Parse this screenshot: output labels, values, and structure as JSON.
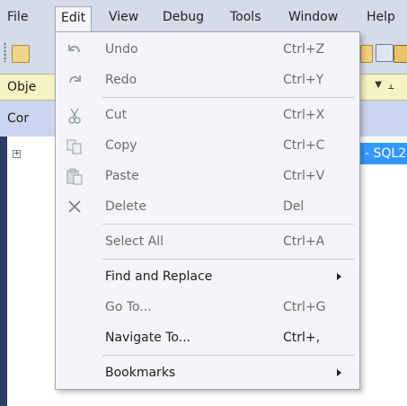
{
  "menubar": {
    "items": [
      "File",
      "Edit",
      "View",
      "Debug",
      "Tools",
      "Window",
      "Help"
    ],
    "open_item": "Edit"
  },
  "panel": {
    "title": "Obje",
    "subheader": "Cor",
    "selected_node": "- SQL2",
    "expander_glyph": "+",
    "pin_glyph": "⫠",
    "dropdown_glyph": "▼"
  },
  "edit_menu": {
    "items": [
      {
        "label": "Undo",
        "shortcut": "Ctrl+Z",
        "enabled": false,
        "icon": "undo-icon"
      },
      {
        "label": "Redo",
        "shortcut": "Ctrl+Y",
        "enabled": false,
        "icon": "redo-icon"
      },
      {
        "label": "Cut",
        "shortcut": "Ctrl+X",
        "enabled": false,
        "icon": "scissors-icon"
      },
      {
        "label": "Copy",
        "shortcut": "Ctrl+C",
        "enabled": false,
        "icon": "copy-icon"
      },
      {
        "label": "Paste",
        "shortcut": "Ctrl+V",
        "enabled": false,
        "icon": "paste-icon"
      },
      {
        "label": "Delete",
        "shortcut": "Del",
        "enabled": false,
        "icon": "delete-x-icon"
      },
      {
        "label": "Select All",
        "shortcut": "Ctrl+A",
        "enabled": false
      },
      {
        "label": "Find and Replace",
        "submenu": true,
        "enabled": true
      },
      {
        "label": "Go To...",
        "shortcut": "Ctrl+G",
        "enabled": false
      },
      {
        "label": "Navigate To...",
        "shortcut": "Ctrl+,",
        "enabled": true
      },
      {
        "label": "Bookmarks",
        "submenu": true,
        "enabled": true
      }
    ]
  },
  "colors": {
    "chrome": "#d6dbe9",
    "menu_bg": "#f4f5f8",
    "menu_border": "#9ea6b9",
    "disabled_text": "#6d6d6d",
    "selection": "#3399ff",
    "panel_header": "#f5f3c3"
  }
}
